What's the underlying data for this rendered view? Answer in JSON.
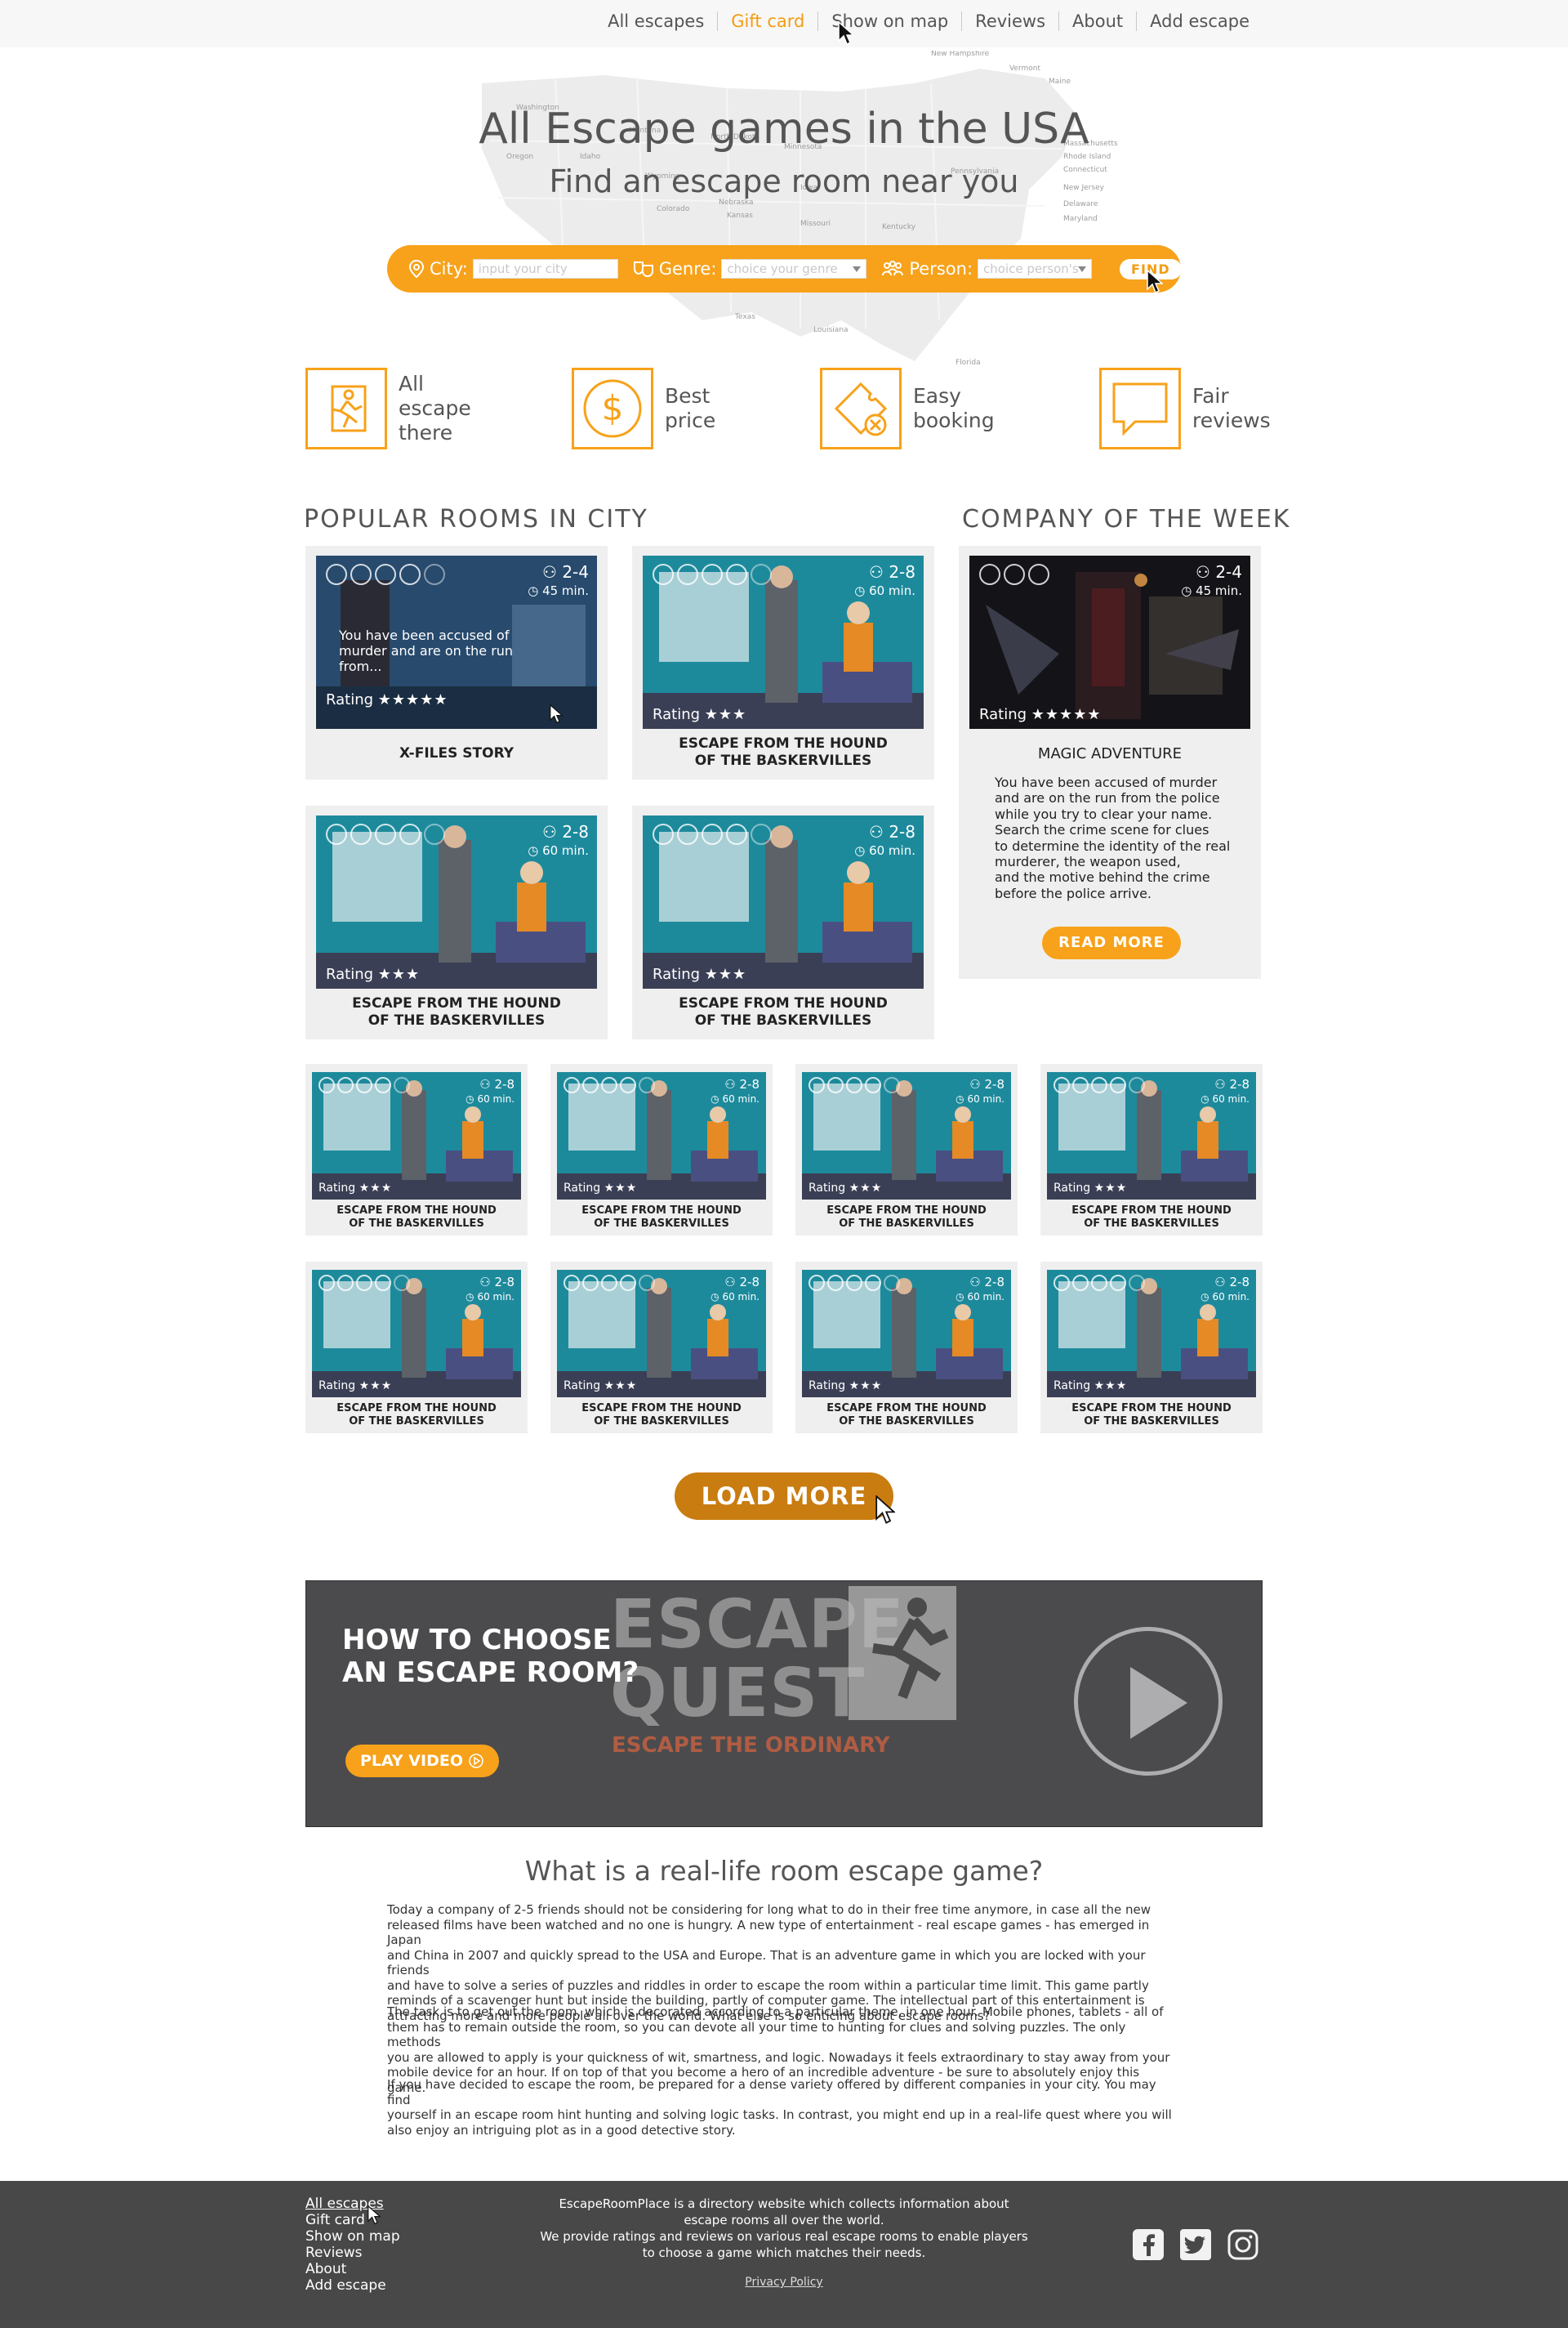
{
  "nav": {
    "items": [
      "All escapes",
      "Gift card",
      "Show on map",
      "Reviews",
      "About",
      "Add escape"
    ],
    "active_index": 1
  },
  "hero": {
    "title": "All Escape games in the USA",
    "subtitle": "Find an escape room near you",
    "map_states": [
      "Washington",
      "Montana",
      "North Dakota",
      "Oregon",
      "Idaho",
      "Minnesota",
      "Wyoming",
      "Iowa",
      "Nebraska",
      "Colorado",
      "Kansas",
      "Missouri",
      "Kentucky",
      "Pennsylvania",
      "Texas",
      "Louisiana",
      "Florida",
      "Vermont",
      "New Hampshire",
      "Maine",
      "Rhode Island",
      "Connecticut",
      "New Jersey",
      "Delaware",
      "Maryland",
      "Massachusetts"
    ]
  },
  "search": {
    "city_label": "City:",
    "city_placeholder": "input your city",
    "genre_label": "Genre:",
    "genre_placeholder": "choice your genre",
    "person_label": "Person:",
    "person_placeholder": "choice person's",
    "find_label": "FIND"
  },
  "features": [
    {
      "icon": "running-man-icon",
      "lines": [
        "All",
        "escape",
        "there"
      ]
    },
    {
      "icon": "dollar-icon",
      "lines": [
        "Best",
        "price"
      ]
    },
    {
      "icon": "ticket-icon",
      "lines": [
        "Easy",
        "booking"
      ]
    },
    {
      "icon": "chat-icon",
      "lines": [
        "Fair",
        "reviews"
      ]
    }
  ],
  "popular": {
    "heading": "POPULAR ROOMS IN CITY",
    "rating_label": "Rating",
    "big_rooms": [
      {
        "name": "X-FILES STORY",
        "persons": "2-4",
        "time": "45 min.",
        "stars": "★★★★★",
        "description": "You have been accused of murder and are on the run from...",
        "brains_total": 5,
        "brains_lit": 4
      },
      {
        "name_line1": "ESCAPE FROM THE HOUND",
        "name_line2": "OF THE BASKERVILLES",
        "persons": "2-8",
        "time": "60 min.",
        "stars": "★★★"
      },
      {
        "name_line1": "ESCAPE FROM THE HOUND",
        "name_line2": "OF THE BASKERVILLES",
        "persons": "2-8",
        "time": "60 min.",
        "stars": "★★★"
      },
      {
        "name_line1": "ESCAPE FROM THE HOUND",
        "name_line2": "OF THE BASKERVILLES",
        "persons": "2-8",
        "time": "60 min.",
        "stars": "★★★"
      }
    ],
    "small_rooms": {
      "name_line1": "ESCAPE FROM THE HOUND",
      "name_line2": "OF THE BASKERVILLES",
      "persons": "2-8",
      "time": "60 min.",
      "stars": "★★★",
      "count": 8
    },
    "load_more": "LOAD MORE"
  },
  "company": {
    "heading": "COMPANY OF THE WEEK",
    "name": "MAGIC ADVENTURE",
    "persons": "2-4",
    "time": "45 min.",
    "stars": "★★★★★",
    "description_lines": [
      "You have been accused of murder",
      "and are on the run from the police",
      "while you try to clear your name.",
      "Search the crime scene for clues",
      "to determine the identity of the real",
      "murderer, the weapon used,",
      "and the motive behind the crime",
      "before the police arrive."
    ],
    "read_more": "READ MORE"
  },
  "video": {
    "headline_line1": "HOW TO CHOOSE",
    "headline_line2": "AN ESCAPE ROOM?",
    "play_label": "PLAY VIDEO",
    "logo_line1": "ESCAPE",
    "logo_line2": "QUEST",
    "logo_tagline": "ESCAPE THE ORDINARY"
  },
  "article": {
    "heading": "What is a real-life room escape game?",
    "paragraphs": [
      [
        "Today a company of 2-5 friends should not be considering for long what to do in their free time anymore, in case all the new",
        "released films have been watched and no one is hungry. A new type of entertainment - real escape games - has emerged in Japan",
        "and China in 2007 and quickly spread to the USA and Europe. That is an adventure game in which you are locked with your friends",
        "and have to solve a series of puzzles and riddles in order to escape the room within a particular time limit. This game partly",
        "reminds of a scavenger hunt but inside the building, partly of computer game. The intellectual part of this entertainment is",
        "attracting more and more people all over the world. What else is so enticing about escape rooms?"
      ],
      [
        "The task is to get out the room, which is decorated according to a particular theme, in one hour. Mobile phones, tablets - all of",
        "them has to remain outside the room, so you can devote all your time to hunting for clues and solving puzzles. The only methods",
        "you are allowed to apply is your quickness of wit, smartness, and logic. Nowadays it feels extraordinary to stay away from your",
        "mobile device for an hour. If on top of that you become a hero of an incredible adventure - be sure to absolutely enjoy this game."
      ],
      [
        "If you have decided to escape the room, be prepared for a dense variety offered by different companies in your city. You may find",
        "yourself in an escape room hint hunting and solving logic tasks. In contrast, you might end up in a real-life quest where you will",
        "also enjoy an intriguing plot as in a good detective story."
      ]
    ]
  },
  "footer": {
    "nav": [
      "All escapes",
      "Gift card",
      "Show on map",
      "Reviews",
      "About",
      "Add escape"
    ],
    "about_lines": [
      "EscapeRoomPlace is a directory website which collects information about",
      "escape rooms all over the world.",
      "We provide ratings and reviews on various real escape rooms to enable players",
      "to choose a game which matches their needs."
    ],
    "privacy": "Privacy Policy",
    "social": [
      "facebook-icon",
      "twitter-icon",
      "instagram-icon"
    ]
  },
  "colors": {
    "accent": "#f7a21a",
    "accent_dark": "#c97c0f",
    "footer_bg": "#484848",
    "card_bg": "#efefef"
  }
}
